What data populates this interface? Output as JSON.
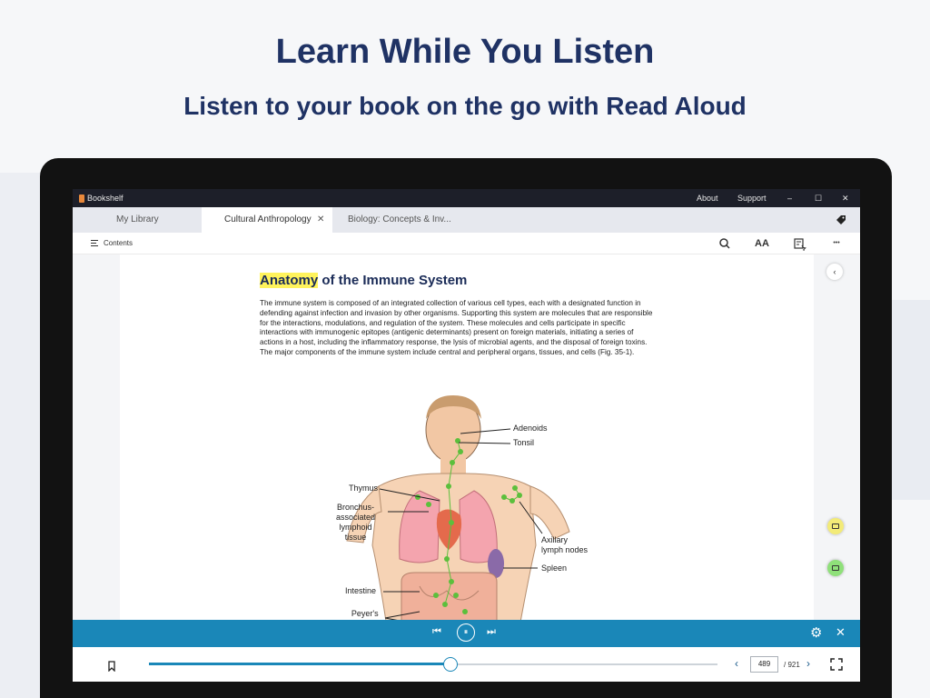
{
  "promo": {
    "headline": "Learn While You Listen",
    "subline": "Listen to your book on the go with Read Aloud"
  },
  "window": {
    "app_name": "Bookshelf",
    "menu": [
      "About",
      "Support"
    ],
    "controls": {
      "minimize": "–",
      "maximize": "☐",
      "close": "✕"
    }
  },
  "tabs": [
    {
      "label": "My Library",
      "active": false
    },
    {
      "label": "Cultural Anthropology",
      "active": true,
      "close": "✕"
    },
    {
      "label": "Biology: Concepts & Inv...",
      "active": false
    }
  ],
  "toolbar": {
    "contents_label": "Contents",
    "search_icon": "search-icon",
    "text_size_icon": "text-size-icon",
    "bookmarks_icon": "bookmark-list-icon",
    "more_icon": "more-icon",
    "text_size_glyph": "AA",
    "more_glyph": "•••"
  },
  "document": {
    "title_highlight": "Anatomy",
    "title_rest": " of the Immune System",
    "body": "The immune system is composed of an integrated collection of various cell types, each with a designated function in defending against infection and invasion by other organisms. Supporting this system are molecules that are responsible for the interactions, modulations, and regulation of the system. These molecules and cells participate in specific interactions with immunogenic epitopes (antigenic determinants) present on foreign materials, initiating a series of actions in a host, including the inflammatory response, the lysis of microbial agents, and the disposal of foreign toxins. The major components of the immune system include central and peripheral organs, tissues, and cells (Fig. 35-1).",
    "figure_labels": {
      "adenoids": "Adenoids",
      "tonsil": "Tonsil",
      "thymus": "Thymus",
      "bronchus": "Bronchus-\nassociated\nlymphoid\ntissue",
      "axillary": "Axillary\nlymph nodes",
      "spleen": "Spleen",
      "intestine": "Intestine",
      "peyers": "Peyer's\npatches"
    }
  },
  "side": {
    "collapse_glyph": "‹"
  },
  "player": {
    "prev_glyph": "⏮",
    "pause_glyph": "⏸",
    "next_glyph": "⏭",
    "settings_glyph": "⚙",
    "close_glyph": "✕"
  },
  "bottom": {
    "current_page": "489",
    "total_pages": "/ 921",
    "progress": 0.53,
    "prev_glyph": "‹",
    "next_glyph": "›"
  },
  "colors": {
    "accent": "#1a87b8",
    "headline": "#1f3264",
    "highlight": "#fff35c",
    "note_yellow": "#f3eb78",
    "note_green": "#8fe07a"
  }
}
